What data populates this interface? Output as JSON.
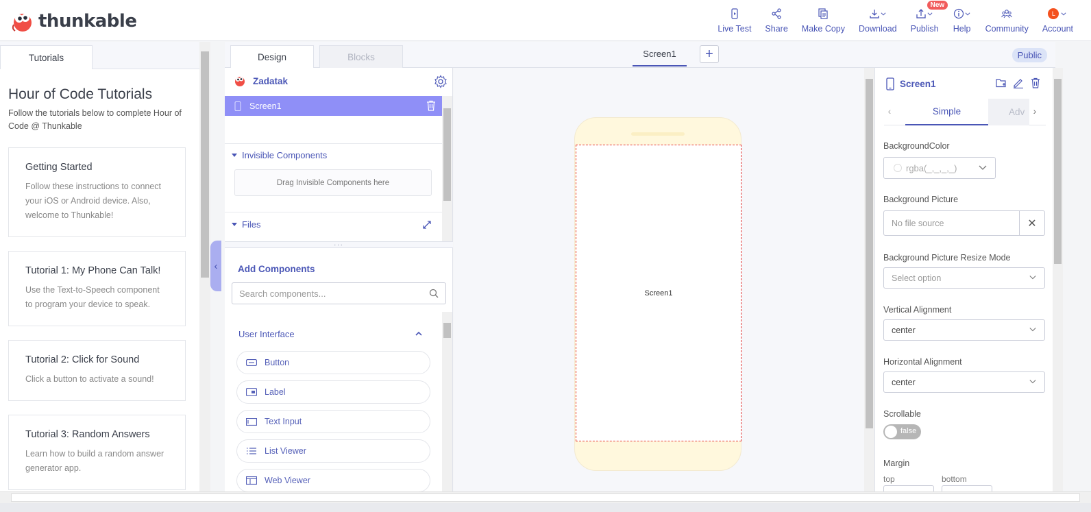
{
  "brand": {
    "name": "thunkable"
  },
  "nav": [
    {
      "label": "Live Test",
      "icon": "phone-icon"
    },
    {
      "label": "Share",
      "icon": "share-icon"
    },
    {
      "label": "Make Copy",
      "icon": "copy-icon"
    },
    {
      "label": "Download",
      "icon": "download-icon"
    },
    {
      "label": "Publish",
      "icon": "publish-icon",
      "badge": "New"
    },
    {
      "label": "Help",
      "icon": "info-icon"
    },
    {
      "label": "Community",
      "icon": "community-icon"
    },
    {
      "label": "Account",
      "icon": "avatar",
      "avatar_letter": "L"
    }
  ],
  "tutorials": {
    "tab": "Tutorials",
    "title": "Hour of Code Tutorials",
    "subtitle": "Follow the tutorials below to complete Hour of Code @ Thunkable",
    "cards": [
      {
        "title": "Getting Started",
        "desc": "Follow these instructions to connect your iOS or Android device. Also, welcome to Thunkable!"
      },
      {
        "title": "Tutorial 1: My Phone Can Talk!",
        "desc": "Use the Text-to-Speech component to program your device to speak."
      },
      {
        "title": "Tutorial 2: Click for Sound",
        "desc": "Click a button to activate a sound!"
      },
      {
        "title": "Tutorial 3: Random Answers",
        "desc": "Learn how to build a random answer generator app."
      }
    ]
  },
  "editor": {
    "tabs": {
      "design": "Design",
      "blocks": "Blocks"
    },
    "screen_tab": "Screen1",
    "add_label": "+",
    "visibility": "Public"
  },
  "tree": {
    "app_name": "Zadatak",
    "screen": "Screen1",
    "invisible_label": "Invisible Components",
    "drop_hint": "Drag Invisible Components here",
    "files_label": "Files"
  },
  "palette": {
    "title": "Add Components",
    "search_placeholder": "Search components...",
    "category": "User Interface",
    "items": [
      "Button",
      "Label",
      "Text Input",
      "List Viewer",
      "Web Viewer"
    ]
  },
  "canvas": {
    "screen_label": "Screen1"
  },
  "props": {
    "title": "Screen1",
    "mode_simple": "Simple",
    "mode_advanced": "Adv",
    "bg_color_label": "BackgroundColor",
    "bg_color_value": "rgba(_,_,_,_)",
    "bg_picture_label": "Background Picture",
    "bg_picture_placeholder": "No file source",
    "resize_label": "Background Picture Resize Mode",
    "resize_placeholder": "Select option",
    "valign_label": "Vertical Alignment",
    "valign_value": "center",
    "halign_label": "Horizontal Alignment",
    "halign_value": "center",
    "scrollable_label": "Scrollable",
    "scrollable_value": "false",
    "margin_label": "Margin",
    "margin_top": "top",
    "margin_bottom": "bottom"
  },
  "colors": {
    "accent": "#4a56b6",
    "selected": "#8f8ff7",
    "phone": "#fff8dd",
    "badge": "#f15b5b"
  }
}
